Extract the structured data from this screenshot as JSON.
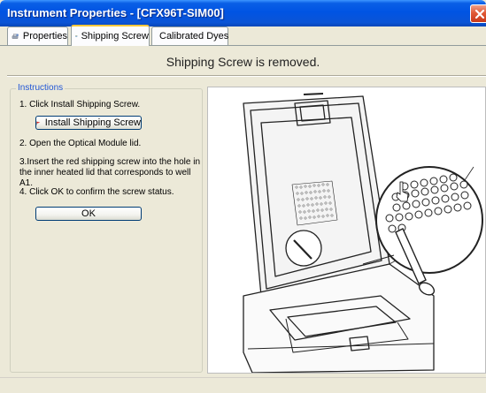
{
  "window": {
    "title": "Instrument Properties - [CFX96T-SIM00]"
  },
  "tabs": [
    {
      "label": "Properties",
      "icon": "properties-icon",
      "active": false
    },
    {
      "label": "Shipping Screw",
      "icon": "shipping-screw-icon",
      "active": true
    },
    {
      "label": "Calibrated Dyes",
      "icon": "calibrated-dyes-icon",
      "active": false
    }
  ],
  "main": {
    "status_message": "Shipping Screw is removed."
  },
  "instructions": {
    "legend": "Instructions",
    "step1": "1. Click Install Shipping Screw.",
    "install_button": "Install Shipping Screw",
    "step2": "2. Open the Optical Module lid.",
    "step3": "3.Insert the red shipping screw into the hole in the inner heated lid that corresponds to well A1.",
    "step4": "4. Click OK to confirm the screw status.",
    "ok_button": "OK"
  },
  "colors": {
    "titlebar": "#0054e3",
    "active_tab_accent": "#ffc83c",
    "legend_text": "#2156d6",
    "flag": "#d8201c"
  }
}
